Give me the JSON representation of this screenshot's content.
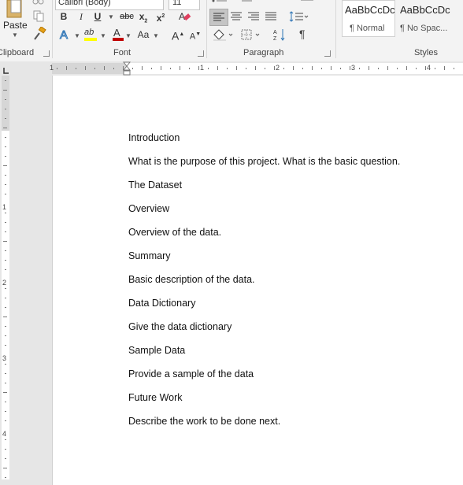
{
  "clipboard": {
    "group_label": "Clipboard",
    "paste_label": "Paste"
  },
  "font": {
    "group_label": "Font",
    "font_name": "Calibri (Body)",
    "font_size": "11",
    "bold": "B",
    "italic": "I",
    "underline": "U",
    "strikethrough": "abc",
    "subscript": "x",
    "superscript": "x",
    "change_case": "Aa",
    "grow": "A",
    "shrink": "A",
    "text_effects": "A",
    "highlight": "ab",
    "font_color": "A"
  },
  "paragraph": {
    "group_label": "Paragraph"
  },
  "styles": {
    "group_label": "Styles",
    "items": [
      {
        "sample": "AaBbCcDc",
        "name": "¶ Normal"
      },
      {
        "sample": "AaBbCcDc",
        "name": "¶ No Spac..."
      }
    ]
  },
  "ruler": {
    "numbers": [
      "1",
      "1",
      "2",
      "3",
      "4"
    ],
    "vnumbers": [
      "1",
      "2",
      "3",
      "4"
    ]
  },
  "document": {
    "paragraphs": [
      "Introduction",
      "What is the purpose of this project.  What is the basic question.",
      "The Dataset",
      "Overview",
      "Overview of the data.",
      "Summary",
      "Basic description of the data.",
      "Data Dictionary",
      "Give the data dictionary",
      "Sample Data",
      "Provide a sample of the data",
      "Future Work",
      "Describe the work to be done next."
    ]
  },
  "colors": {
    "highlight": "#ffff00",
    "font_color": "#c00000",
    "text_effects": "#2e75b6",
    "eraser": "#e04060"
  }
}
